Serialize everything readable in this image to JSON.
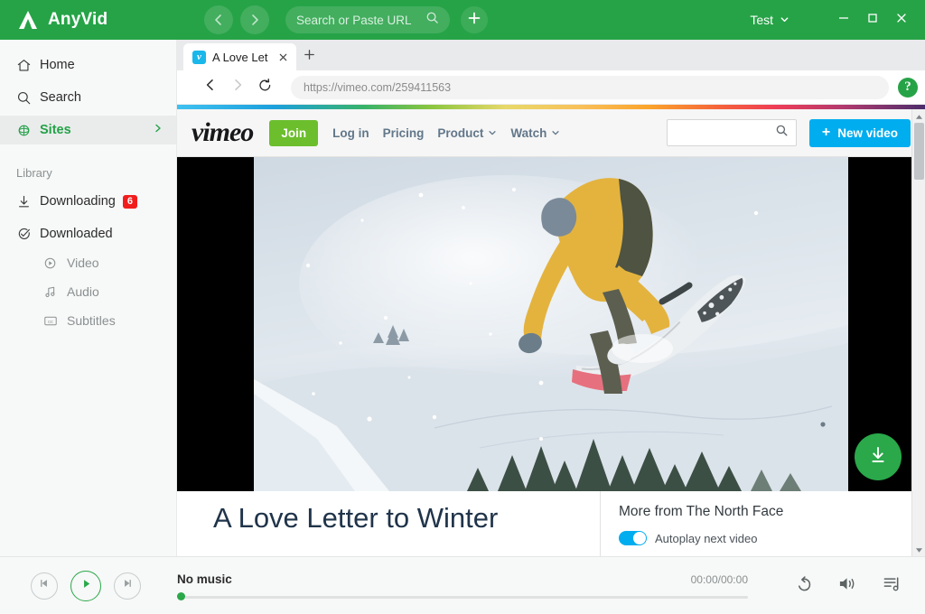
{
  "app": {
    "name": "AnyVid",
    "logo_icon": "anyvid-a-logo",
    "accent_green": "#26a347",
    "badge_red": "#f11d1d"
  },
  "titlebar": {
    "back_icon": "chevron-left-icon",
    "forward_icon": "chevron-right-icon",
    "search": {
      "placeholder": "Search or Paste URL",
      "value": "",
      "icon": "search-icon"
    },
    "add_icon": "plus-icon",
    "account_label": "Test",
    "account_caret_icon": "chevron-down-icon",
    "minimize_icon": "minimize-icon",
    "maximize_icon": "maximize-icon",
    "close_icon": "close-icon"
  },
  "sidebar": {
    "items": [
      {
        "label": "Home",
        "icon": "home-icon",
        "active": false
      },
      {
        "label": "Search",
        "icon": "search-icon",
        "active": false
      },
      {
        "label": "Sites",
        "icon": "globe-icon",
        "active": true,
        "chevron": "chevron-right-icon"
      }
    ],
    "library_label": "Library",
    "library_items": [
      {
        "label": "Downloading",
        "icon": "download-arrow-icon",
        "badge": "6"
      },
      {
        "label": "Downloaded",
        "icon": "check-circle-icon",
        "badge": ""
      }
    ],
    "sub_items": [
      {
        "label": "Video",
        "icon": "play-circle-icon"
      },
      {
        "label": "Audio",
        "icon": "music-note-icon"
      },
      {
        "label": "Subtitles",
        "icon": "closed-caption-icon"
      }
    ]
  },
  "browser": {
    "tab": {
      "title": "A Love Let",
      "favicon_label": "v",
      "favicon_color": "#1ab7ea",
      "close_icon": "close-icon"
    },
    "new_tab_icon": "plus-icon",
    "back_icon": "arrow-left-icon",
    "forward_icon": "arrow-right-icon",
    "reload_icon": "reload-icon",
    "url": "https://vimeo.com/259411563",
    "help_label": "?",
    "help_icon": "question-mark-icon"
  },
  "vimeo": {
    "logo_text": "vimeo",
    "join_label": "Join",
    "join_color": "#6cbe2d",
    "nav_links": [
      {
        "label": "Log in",
        "caret": false
      },
      {
        "label": "Pricing",
        "caret": false
      },
      {
        "label": "Product",
        "caret": true
      },
      {
        "label": "Watch",
        "caret": true
      }
    ],
    "search": {
      "value": "",
      "placeholder": "",
      "icon": "search-icon"
    },
    "new_video_label": "New video",
    "new_video_color": "#00adef",
    "new_video_icon": "plus-icon",
    "video_title": "A Love Letter to Winter",
    "more_from": "More from The North Face",
    "autoplay_label": "Autoplay next video",
    "autoplay_on": true,
    "thumbnail_alt": "snowboarder jumping over snowy mountain slope",
    "scroll_up_icon": "triangle-up-icon",
    "scroll_down_icon": "triangle-down-icon"
  },
  "download_fab": {
    "icon": "download-icon",
    "color": "#2aa84a"
  },
  "player": {
    "prev_icon": "skip-previous-icon",
    "play_icon": "play-icon",
    "next_icon": "skip-next-icon",
    "track_title": "No music",
    "time": "00:00/00:00",
    "progress_percent": 0,
    "repeat_icon": "repeat-icon",
    "volume_icon": "volume-icon",
    "queue_icon": "playlist-queue-icon"
  }
}
